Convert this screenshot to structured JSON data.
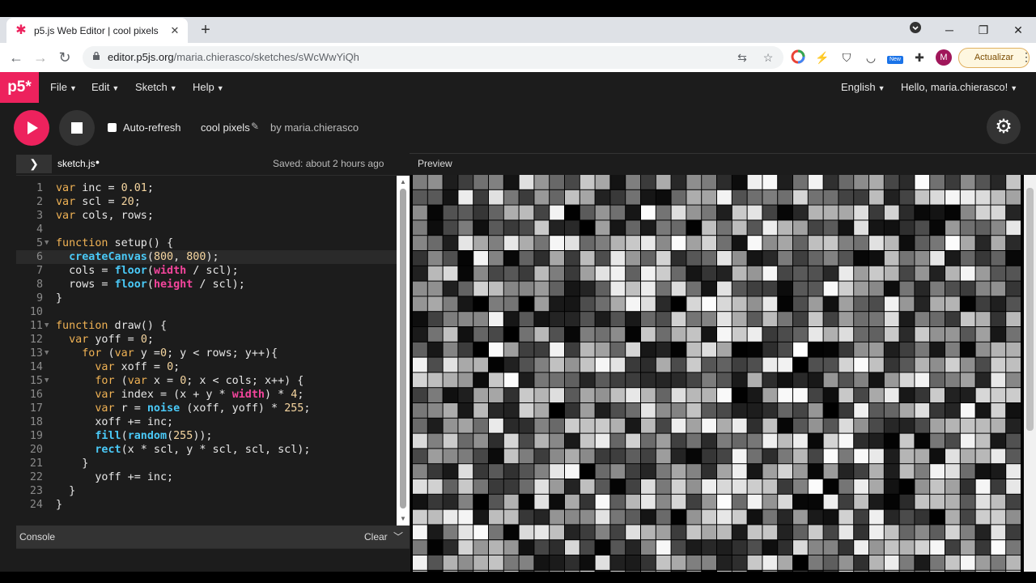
{
  "browser": {
    "tab_title": "p5.js Web Editor | cool pixels",
    "tab_close": "✕",
    "new_tab": "+",
    "url_host": "editor.p5js.org",
    "url_path": "/maria.chierasco/sketches/sWcWwYiQh",
    "update_button": "Actualizar",
    "profile_initial": "M",
    "window_min": "─",
    "window_max": "❐",
    "window_close": "✕",
    "ext_new_badge": "New"
  },
  "editor_app": {
    "logo": "p5*",
    "menus": [
      {
        "label": "File"
      },
      {
        "label": "Edit"
      },
      {
        "label": "Sketch"
      },
      {
        "label": "Help"
      }
    ],
    "language": "English",
    "user_greeting": "Hello, maria.chierasco!",
    "auto_refresh_label": "Auto-refresh",
    "auto_refresh_checked": false,
    "sketch_name": "cool pixels",
    "by_line": "by maria.chierasco",
    "file_name": "sketch.js",
    "unsaved_dot": "●",
    "saved_status": "Saved: about 2 hours ago",
    "preview_label": "Preview",
    "console_label": "Console",
    "clear_label": "Clear",
    "active_line": 6
  },
  "code": [
    "",
    "var inc = 0.01;",
    "var scl = 20;",
    "var cols, rows;",
    "",
    "function setup() {",
    "  createCanvas(800, 800);",
    "  cols = floor(width / scl);",
    "  rows = floor(height / scl);",
    "}",
    "",
    "function draw() {",
    "  var yoff = 0;",
    "    for (var y =0; y < rows; y++){",
    "      var xoff = 0;",
    "      for (var x = 0; x < cols; x++) {",
    "      var index = (x + y * width) * 4;",
    "      var r = noise (xoff, yoff) * 255;",
    "      xoff += inc;",
    "      fill(random(255));",
    "      rect(x * scl, y * scl, scl, scl);",
    "    }",
    "      yoff += inc;",
    "  }",
    "}"
  ],
  "colors": {
    "accent": "#ed225d",
    "editor_bg": "#1c1c1c",
    "chrome_bg": "#dee1e6"
  }
}
